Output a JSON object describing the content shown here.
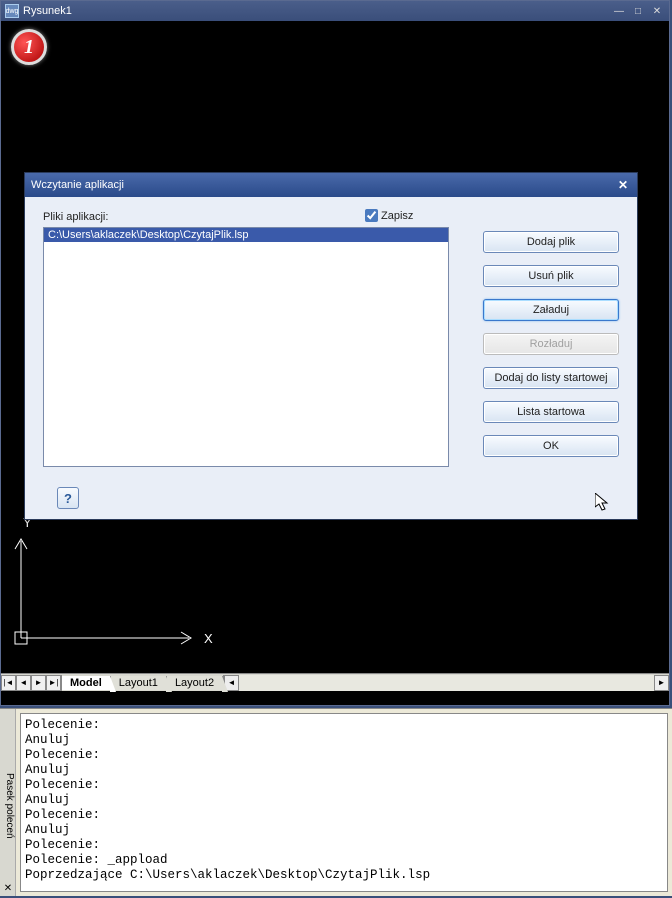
{
  "window": {
    "title": "Rysunek1"
  },
  "badge": {
    "number": "1"
  },
  "ucs": {
    "y": "Y",
    "x": "X"
  },
  "tabs": {
    "active": "Model",
    "items": [
      "Model",
      "Layout1",
      "Layout2"
    ]
  },
  "dialog": {
    "title": "Wczytanie aplikacji",
    "files_label": "Pliki aplikacji:",
    "save_checkbox": "Zapisz",
    "save_checked": true,
    "file_item": "C:\\Users\\aklaczek\\Desktop\\CzytajPlik.lsp",
    "buttons": {
      "add": "Dodaj plik",
      "remove": "Usuń plik",
      "load": "Załaduj",
      "unload": "Rozładuj",
      "add_startup": "Dodaj do listy startowej",
      "startup_list": "Lista startowa",
      "ok": "OK"
    },
    "help": "?"
  },
  "cmd_panel_label": "Pasek poleceń",
  "cmd_lines": "Polecenie:\nAnuluj\nPolecenie:\nAnuluj\nPolecenie:\nAnuluj\nPolecenie:\nAnuluj\nPolecenie:\nPolecenie: _appload\nPoprzedzające C:\\Users\\aklaczek\\Desktop\\CzytajPlik.lsp"
}
